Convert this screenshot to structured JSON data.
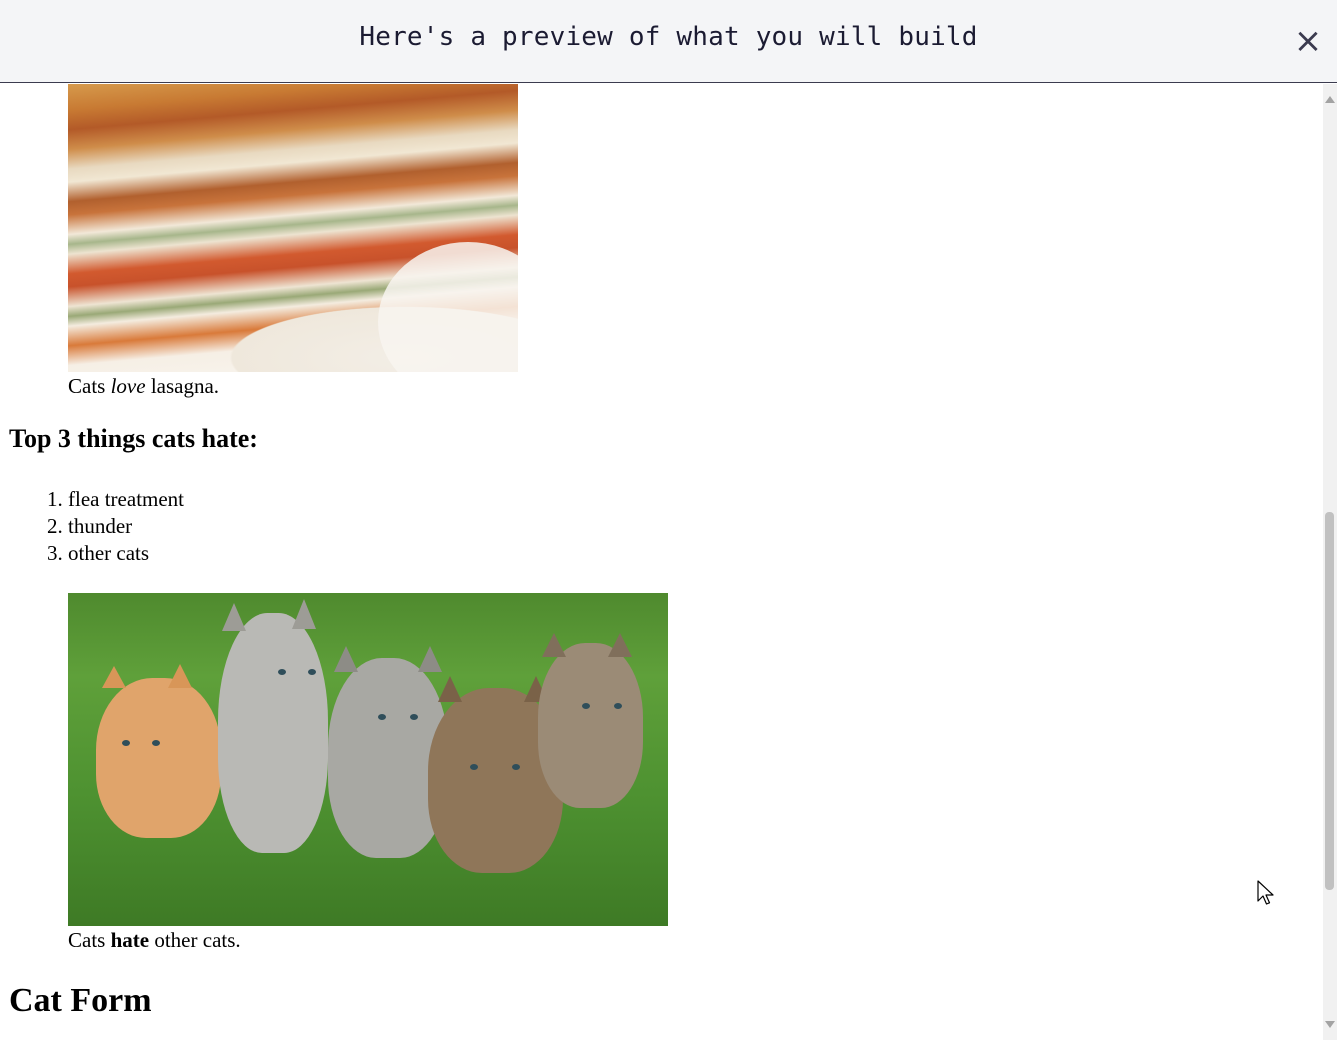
{
  "banner": {
    "title": "Here's a preview of what you will build",
    "close_label": "×"
  },
  "lasagna": {
    "alt": "A slice of lasagna on a plate.",
    "caption_pre": "Cats ",
    "caption_em": "love",
    "caption_post": " lasagna."
  },
  "hate": {
    "heading": "Top 3 things cats hate:",
    "items": [
      "flea treatment",
      "thunder",
      "other cats"
    ]
  },
  "kittens": {
    "alt": "Five cats looking around a field.",
    "caption_pre": "Cats ",
    "caption_strong": "hate",
    "caption_post": " other cats."
  },
  "form": {
    "heading": "Cat Form"
  }
}
